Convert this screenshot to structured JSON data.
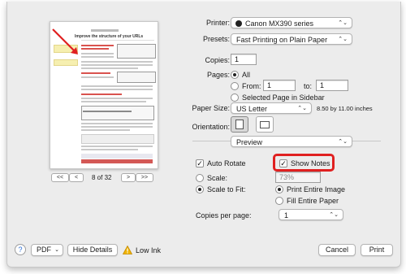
{
  "preview": {
    "page_title": "Improve the structure of your URLs",
    "page_indicator": "8 of 32",
    "nav": {
      "first": "<<",
      "prev": "<",
      "next": ">",
      "last": ">>"
    }
  },
  "printer": {
    "label": "Printer:",
    "value": "Canon MX390 series"
  },
  "presets": {
    "label": "Presets:",
    "value": "Fast Printing on Plain Paper"
  },
  "copies": {
    "label": "Copies:",
    "value": "1"
  },
  "pages": {
    "label": "Pages:",
    "all": "All",
    "from_label": "From:",
    "from_value": "1",
    "to_label": "to:",
    "to_value": "1",
    "selected": "Selected Page in Sidebar"
  },
  "paper_size": {
    "label": "Paper Size:",
    "value": "US Letter",
    "dimensions": "8.50 by 11.00 inches"
  },
  "orientation": {
    "label": "Orientation:"
  },
  "section_popup": {
    "value": "Preview"
  },
  "auto_rotate": {
    "label": "Auto Rotate",
    "checked": true
  },
  "show_notes": {
    "label": "Show Notes",
    "checked": true
  },
  "scale": {
    "label": "Scale:",
    "value": "73%"
  },
  "scale_to_fit": {
    "label": "Scale to Fit:",
    "print_entire": "Print Entire Image",
    "fill_entire": "Fill Entire Paper"
  },
  "copies_per_page": {
    "label": "Copies per page:",
    "value": "1"
  },
  "footer": {
    "help": "?",
    "pdf": "PDF",
    "hide_details": "Hide Details",
    "low_ink": "Low Ink",
    "cancel": "Cancel",
    "print": "Print"
  },
  "colors": {
    "highlight": "#e02020",
    "annotation_yellow": "#f6efb0"
  }
}
